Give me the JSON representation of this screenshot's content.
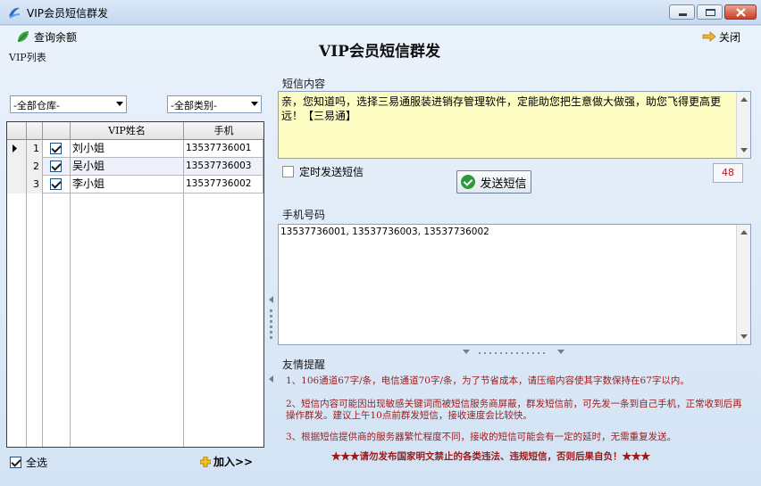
{
  "window": {
    "title": "VIP会员短信群发",
    "icon": "app-logo-icon"
  },
  "toolbar": {
    "query_balance_label": "查询余额",
    "close_label": "关闭"
  },
  "page_title": "VIP会员短信群发",
  "vip_list": {
    "group_label": "VIP列表",
    "warehouse_select": "-全部仓库-",
    "category_select": "-全部类别-",
    "columns": {
      "name": "VIP姓名",
      "phone": "手机"
    },
    "rows": [
      {
        "num": "1",
        "checked": true,
        "name": "刘小姐",
        "phone": "13537736001",
        "current": true
      },
      {
        "num": "2",
        "checked": true,
        "name": "吴小姐",
        "phone": "13537736003",
        "current": false
      },
      {
        "num": "3",
        "checked": true,
        "name": "李小姐",
        "phone": "13537736002",
        "current": false
      }
    ],
    "select_all_label": "全选",
    "select_all_checked": true,
    "add_label": "加入>>"
  },
  "sms": {
    "label": "短信内容",
    "content": "亲，您知道吗，选择三易通服装进销存管理软件，定能助您把生意做大做强，助您飞得更高更远！【三易通】",
    "timed_send_label": "定时发送短信",
    "timed_send_checked": false,
    "send_button_label": "发送短信",
    "char_count": "48"
  },
  "phones": {
    "label": "手机号码",
    "value": "13537736001, 13537736003, 13537736002"
  },
  "tips": {
    "label": "友情提醒",
    "items": [
      "1、106通道67字/条，电信通道70字/条，为了节省成本，请压缩内容使其字数保持在67字以内。",
      "2、短信内容可能因出现敏感关键词而被短信服务商屏蔽，群发短信前，可先发一条到自己手机，正常收到后再操作群发。建议上午10点前群发短信，接收速度会比较快。",
      "3、根据短信提供商的服务器繁忙程度不同，接收的短信可能会有一定的延时，无需重复发送。",
      "★★★请勿发布国家明文禁止的各类违法、违规短信，否则后果自负！★★★"
    ]
  },
  "colors": {
    "sms_background": "#fdfcc3",
    "tip_text": "#9b1b1b",
    "count_text": "#b41818",
    "send_icon": "#2c9a3a"
  }
}
